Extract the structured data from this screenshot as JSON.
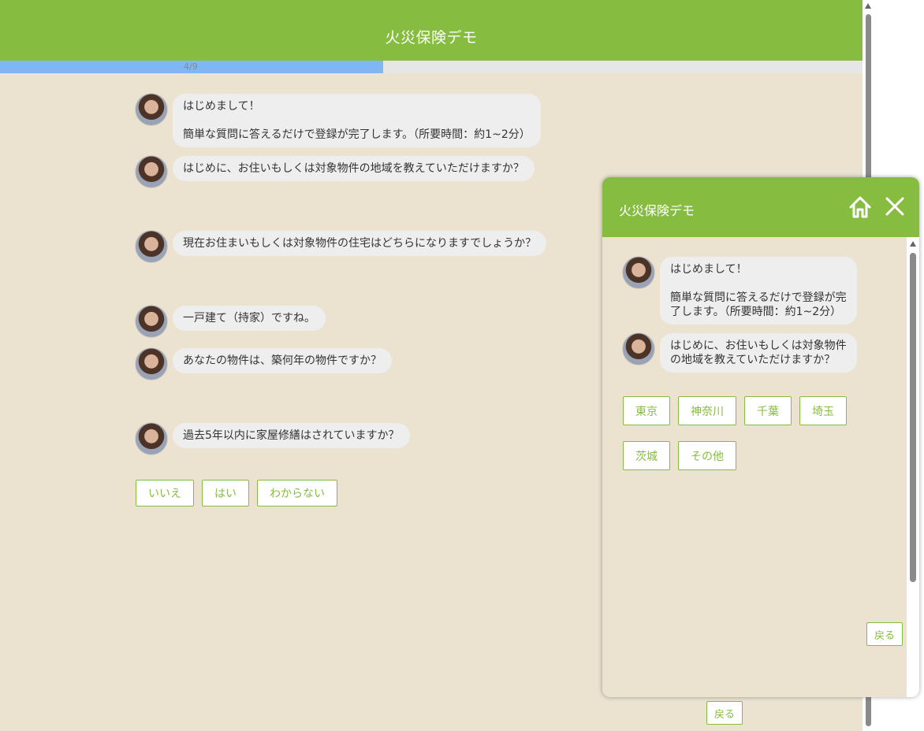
{
  "header": {
    "title": "火災保険デモ"
  },
  "progress": {
    "label": "4/9",
    "fraction": 0.444
  },
  "messages": [
    {
      "line1": "はじめまして！",
      "line2": "簡単な質問に答えるだけで登録が完了します。（所要時間：約1~2分）"
    },
    {
      "text": "はじめに、お住いもしくは対象物件の地域を教えていただけますか？"
    },
    {
      "text": "現在お住まいもしくは対象物件の住宅はどちらになりますでしょうか？"
    },
    {
      "text": "一戸建て（持家）ですね。"
    },
    {
      "text": "あなたの物件は、築何年の物件ですか？"
    },
    {
      "text": "過去5年以内に家屋修繕はされていますか？"
    }
  ],
  "choices": [
    "いいえ",
    "はい",
    "わからない"
  ],
  "back_label": "戻る",
  "widget": {
    "title": "火災保険デモ",
    "messages": [
      {
        "line1": "はじめまして！",
        "line2": "簡単な質問に答えるだけで登録が完了します。（所要時間：約1~2分）"
      },
      {
        "text": "はじめに、お住いもしくは対象物件の地域を教えていただけますか？"
      }
    ],
    "choices": [
      "東京",
      "神奈川",
      "千葉",
      "埼玉",
      "茨城",
      "その他"
    ],
    "back_label": "戻る"
  },
  "colors": {
    "accent": "#86bd40",
    "background": "#ebe3d0",
    "progress": "#7fb7f5"
  },
  "icons": {
    "home": "home-icon",
    "close": "close-icon",
    "avatar": "avatar"
  }
}
